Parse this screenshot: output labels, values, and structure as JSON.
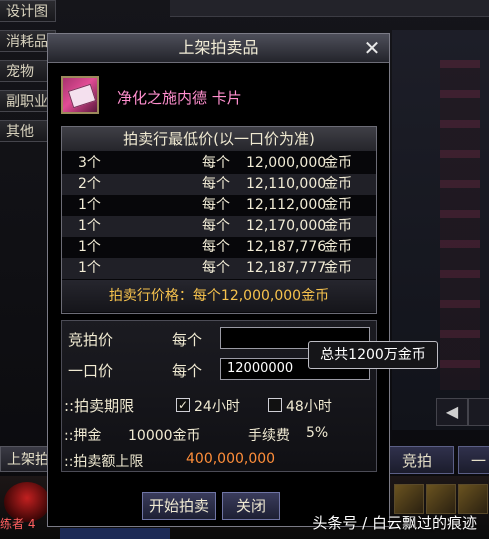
{
  "background": {
    "nav_items": [
      "设计图",
      "消耗品",
      "宠物",
      "副职业",
      "其他"
    ],
    "shelf_button": "上架拍",
    "bid_button": "竞拍",
    "buy_button": "一",
    "level_text": "练者 4"
  },
  "dialog": {
    "title": "上架拍卖品",
    "item": {
      "name": "净化之施内德  卡片"
    },
    "price_table": {
      "header": "拍卖行最低价(以一口价为准)",
      "per_label": "每个",
      "unit": "金币",
      "rows": [
        {
          "qty": "3个",
          "amount": "12,000,000"
        },
        {
          "qty": "2个",
          "amount": "12,110,000"
        },
        {
          "qty": "1个",
          "amount": "12,112,000"
        },
        {
          "qty": "1个",
          "amount": "12,170,000"
        },
        {
          "qty": "1个",
          "amount": "12,187,776"
        },
        {
          "qty": "1个",
          "amount": "12,187,777"
        }
      ],
      "market_price": "拍卖行价格：每个12,000,000金币"
    },
    "form": {
      "bid_label": "竞拍价",
      "per_label": "每个",
      "bid_value": "",
      "buyout_label": "一口价",
      "buyout_value": "12000000",
      "duration_label": "::拍卖期限",
      "opt_24": "24小时",
      "opt_48": "48小时",
      "opt_24_checked": true,
      "opt_48_checked": false,
      "deposit_label": "::押金",
      "deposit_value": "10000金币",
      "fee_label": "手续费",
      "fee_value": "5%",
      "limit_label": "::拍卖额上限",
      "limit_value": "400,000,000"
    },
    "tooltip": "总共1200万金币",
    "start_button": "开始拍卖",
    "close_button": "关闭"
  },
  "watermark": "头条号 / 白云飘过的痕迹",
  "colors": {
    "item_name": "#ff8fce",
    "market_price": "#f6c24d",
    "limit_value": "#ff8e3a"
  }
}
